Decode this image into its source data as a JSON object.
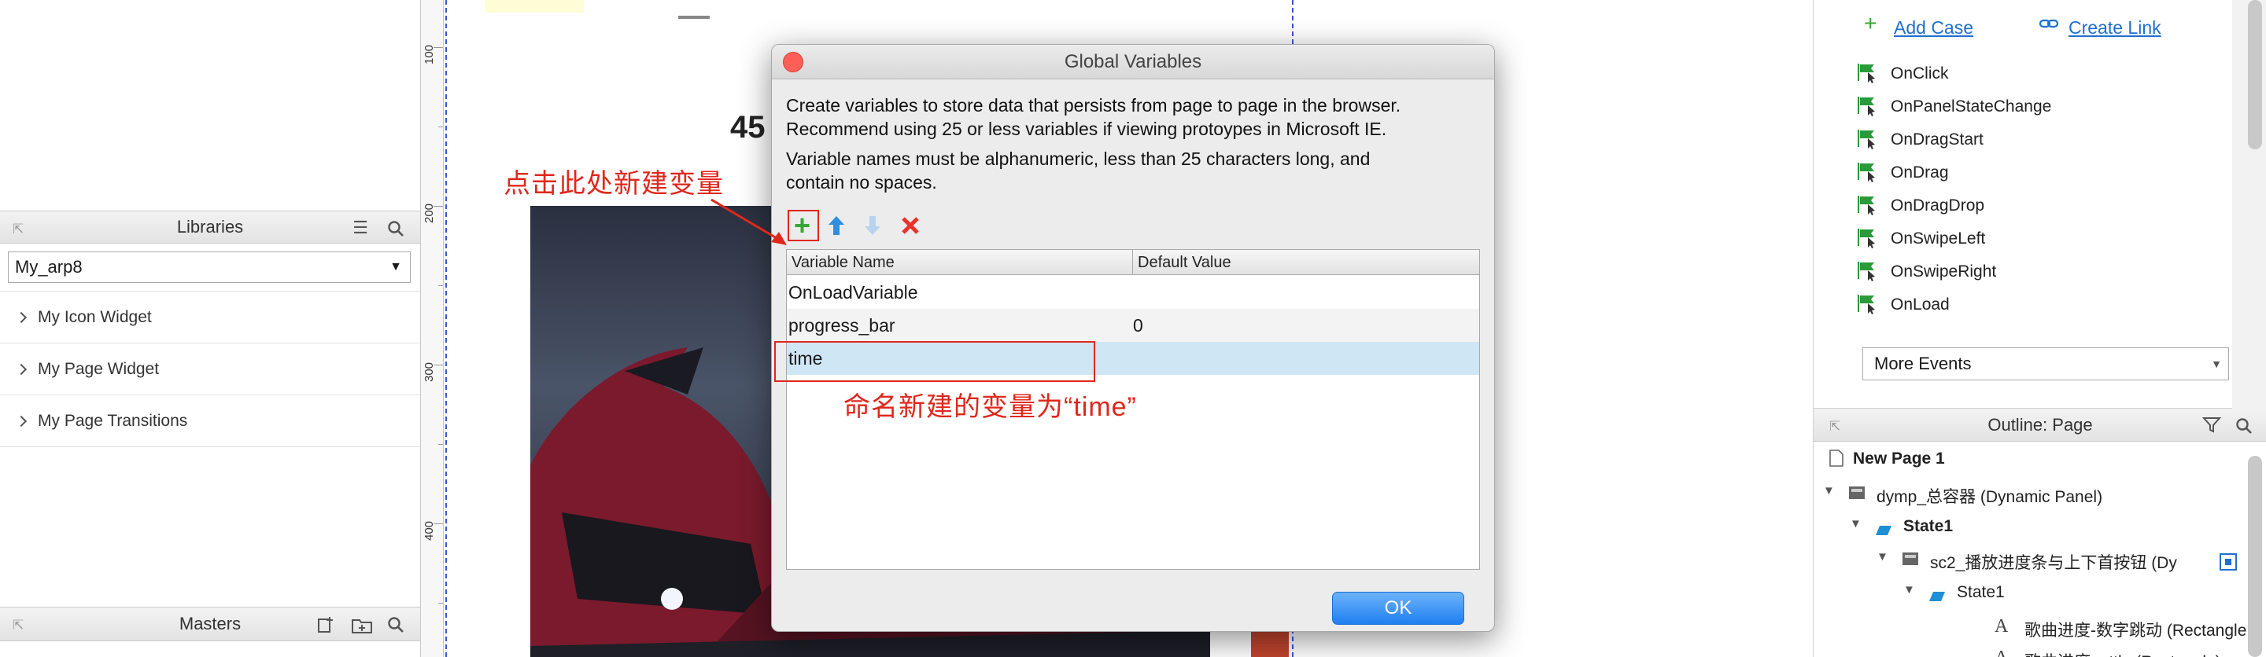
{
  "left_panel": {
    "libraries": {
      "title": "Libraries",
      "selected": "My_arp8",
      "items": [
        "My Icon Widget",
        "My Page Widget",
        "My Page Transitions"
      ]
    },
    "masters": {
      "title": "Masters"
    }
  },
  "ruler": {
    "labels": [
      "100",
      "200",
      "300",
      "400"
    ]
  },
  "canvas": {
    "partial_text": "45"
  },
  "dialog": {
    "title": "Global Variables",
    "description_1": "Create variables to store data that persists from page to page in the browser.",
    "description_2": "Recommend using 25 or less variables if viewing protoypes in Microsoft IE.",
    "rule_1": "Variable names must be alphanumeric, less than 25 characters long, and",
    "rule_2": "contain no spaces.",
    "columns": {
      "name": "Variable Name",
      "default": "Default Value"
    },
    "rows": [
      {
        "name": "OnLoadVariable",
        "default": ""
      },
      {
        "name": "progress_bar",
        "default": "0"
      },
      {
        "name": "time",
        "default": ""
      }
    ],
    "ok_label": "OK"
  },
  "annotations": {
    "click_here": "点击此处新建变量",
    "name_var": "命名新建的变量为“time”",
    "accent": "#e0271c"
  },
  "interactions": {
    "add_case": "Add Case",
    "create_link": "Create Link",
    "events": [
      "OnClick",
      "OnPanelStateChange",
      "OnDragStart",
      "OnDrag",
      "OnDragDrop",
      "OnSwipeLeft",
      "OnSwipeRight",
      "OnLoad"
    ],
    "more_events": "More Events"
  },
  "outline": {
    "title": "Outline: Page",
    "items": [
      {
        "label": "New Page 1"
      },
      {
        "label": "dymp_总容器 (Dynamic Panel)"
      },
      {
        "label": "State1"
      },
      {
        "label": "sc2_播放进度条与上下首按钮 (Dy"
      },
      {
        "label": "State1"
      },
      {
        "label": "歌曲进度-数字跳动 (Rectangle"
      },
      {
        "label": "歌曲进度 ...ttle (Rectangle)"
      }
    ]
  }
}
